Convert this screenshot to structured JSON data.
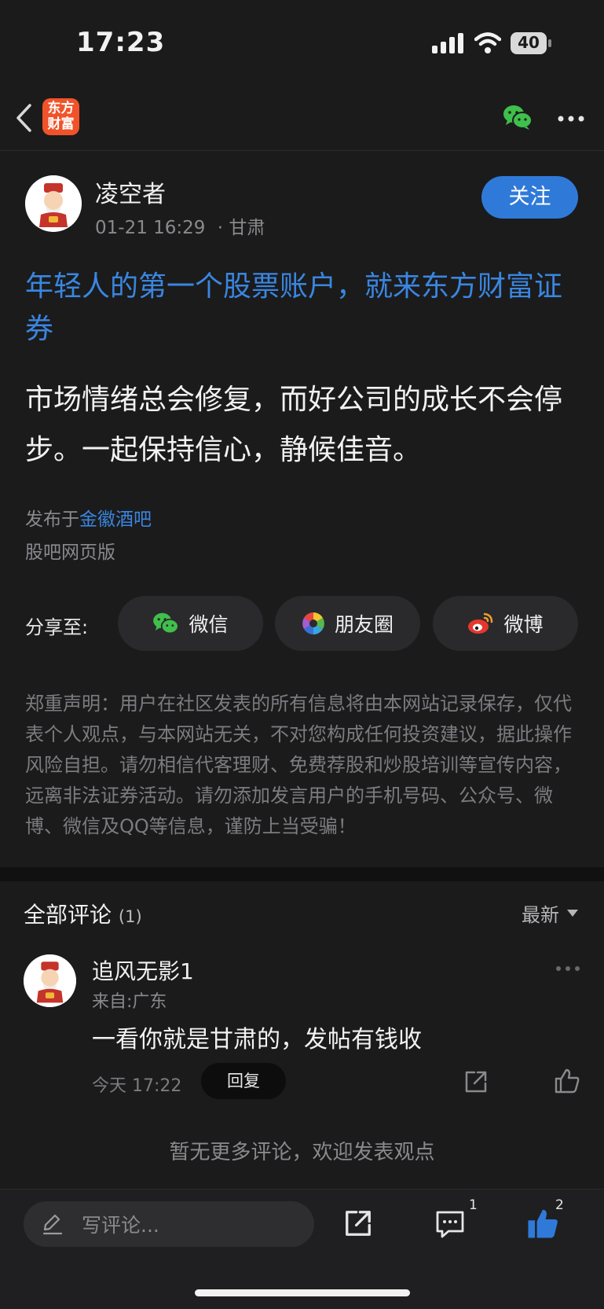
{
  "status_bar": {
    "time": "17:23",
    "battery": "40"
  },
  "nav": {
    "logo_text": "东方财富"
  },
  "post": {
    "author": "凌空者",
    "datetime": "01-21 16:29",
    "location": "· 甘肃",
    "follow_label": "关注",
    "headline": "年轻人的第一个股票账户，就来东方财富证券",
    "body": "市场情绪总会修复，而好公司的成长不会停步。一起保持信心，静候佳音。",
    "published_prefix": "发布于",
    "published_bar": "金徽酒吧",
    "source": "股吧网页版"
  },
  "share": {
    "label": "分享至:",
    "wechat": "微信",
    "moments": "朋友圈",
    "weibo": "微博"
  },
  "disclaimer": "郑重声明：用户在社区发表的所有信息将由本网站记录保存，仅代表个人观点，与本网站无关，不对您构成任何投资建议，据此操作风险自担。请勿相信代客理财、免费荐股和炒股培训等宣传内容，远离非法证券活动。请勿添加发言用户的手机号码、公众号、微博、微信及QQ等信息，谨防上当受骗！",
  "comments": {
    "title": "全部评论",
    "count": "(1)",
    "sort_label": "最新",
    "items": [
      {
        "user": "追风无影1",
        "from": "来自:广东",
        "text": "一看你就是甘肃的，发帖有钱收",
        "time": "今天 17:22",
        "reply_label": "回复"
      }
    ],
    "no_more": "暂无更多评论，欢迎发表观点"
  },
  "bottom_bar": {
    "input_placeholder": "写评论...",
    "comment_count": "1",
    "like_count": "2"
  },
  "colors": {
    "accent": "#2f7ad9",
    "link": "#3a86e0",
    "brand": "#f0532a",
    "background": "#1b1b1c"
  }
}
